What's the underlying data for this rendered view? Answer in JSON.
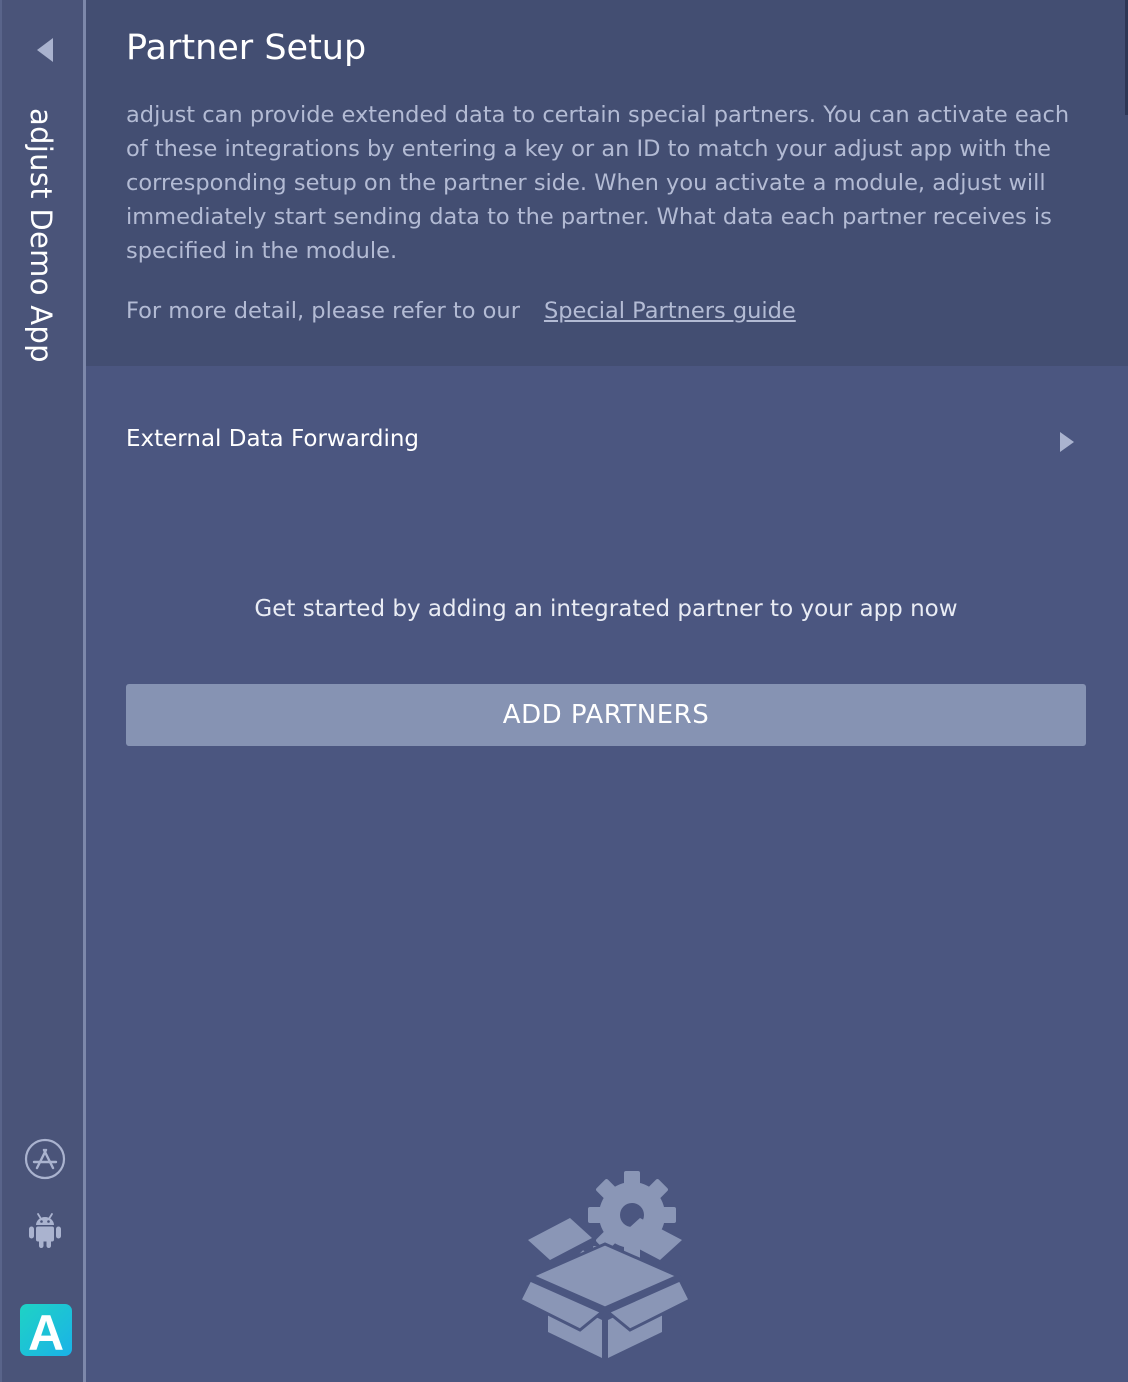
{
  "sidebar": {
    "app_name": "adjust Demo App",
    "back_icon": "chevron-left-icon",
    "platform_icons": [
      "app-store-icon",
      "android-icon"
    ],
    "logo_icon": "adjust-logo",
    "logo_letter": "A"
  },
  "header": {
    "title": "Partner Setup",
    "intro": "adjust can provide extended data to certain special partners. You can activate each of these integrations by entering a key or an ID to match your adjust app with the corresponding setup on the partner side. When you activate a module, adjust will immediately start sending data to the partner. What data each partner receives is specified in the module.",
    "more_detail": "For more detail, please refer to our",
    "guide_link": "Special Partners guide"
  },
  "main": {
    "section_title": "External Data Forwarding",
    "empty_message": "Get started by adding an integrated partner to your app now",
    "add_button_label": "ADD PARTNERS",
    "illustration_icon": "box-with-gears-icon"
  },
  "colors": {
    "background": "#4b5680",
    "header_background": "#434e72",
    "button": "#8693b3",
    "logo_gradient_start": "#1fd3c4",
    "logo_gradient_end": "#1ab2e8"
  }
}
